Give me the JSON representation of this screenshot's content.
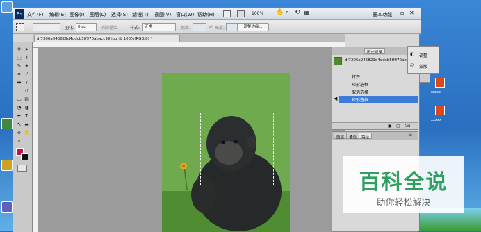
{
  "menu": {
    "app_icon": "Ps",
    "items": [
      "文件(F)",
      "编辑(E)",
      "图像(I)",
      "图层(L)",
      "选择(S)",
      "滤镜(T)",
      "视图(V)",
      "窗口(W)",
      "帮助(H)"
    ],
    "zoom": "100%",
    "workspace": "基本功能"
  },
  "options": {
    "feather_label": "羽化:",
    "feather_value": "0 px",
    "antialias_label": "消除锯齿",
    "style_label": "样式:",
    "style_value": "正常",
    "width_label": "宽度:",
    "height_label": "高度:",
    "refine_button": "调整边缘..."
  },
  "document": {
    "tab_title": "df7306a945829d4ddcb5ff970abacc99.jpg @ 100%(RGB/8) *"
  },
  "history": {
    "tabs": [
      "历史记录"
    ],
    "snapshot_name": "df7306a945829d4ddcb5ff970abacc...",
    "items": [
      "打开",
      "矩形选框",
      "取消选择",
      "矩形选框"
    ],
    "selected_index": 3
  },
  "layers_panel": {
    "tabs": [
      "图层",
      "通道",
      "路径"
    ]
  },
  "adjust_panel": {
    "items": [
      "调整",
      "蒙版"
    ]
  },
  "desktop_icons": [
    {
      "label": "xxxxx",
      "color": "#d64a1e"
    },
    {
      "label": "xxxxx",
      "color": "#d64a1e"
    }
  ],
  "watermark": {
    "title": "百科全说",
    "subtitle": "助你轻松解决",
    "color": "#2fa060"
  },
  "colors": {
    "foreground": "#c0144a",
    "background": "#111111",
    "selection_highlight": "#3d7bd8"
  }
}
